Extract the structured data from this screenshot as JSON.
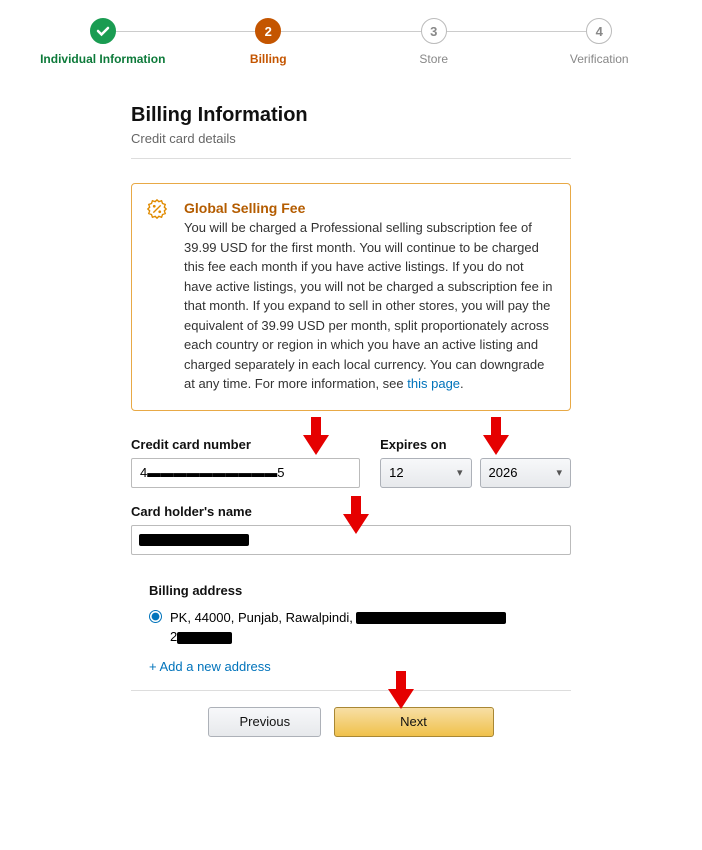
{
  "stepper": {
    "steps": [
      {
        "label": "Individual Information"
      },
      {
        "label": "Billing",
        "num": "2"
      },
      {
        "label": "Store",
        "num": "3"
      },
      {
        "label": "Verification",
        "num": "4"
      }
    ]
  },
  "header": {
    "title": "Billing Information",
    "subtitle": "Credit card details"
  },
  "notice": {
    "title": "Global Selling Fee",
    "body": "You will be charged a Professional selling subscription fee of 39.99 USD for the first month. You will continue to be charged this fee each month if you have active listings. If you do not have active listings, you will not be charged a subscription fee in that month. If you expand to sell in other stores, you will pay the equivalent of 39.99 USD per month, split proportionately across each country or region in which you have an active listing and charged separately in each local currency. You can downgrade at any time. For more information, see ",
    "link_text": "this page",
    "period": "."
  },
  "form": {
    "card_number_label": "Credit card number",
    "card_number_value": "4▬▬▬▬▬▬▬▬▬▬5",
    "expires_label": "Expires on",
    "exp_month": "12",
    "exp_year": "2026",
    "holder_label": "Card holder's name",
    "holder_value": "",
    "billing_label": "Billing address",
    "billing_addr_prefix": "PK, 44000, Punjab, Rawalpindi, ",
    "billing_addr_line2_prefix": "2",
    "add_address": "+ Add a new address"
  },
  "buttons": {
    "previous": "Previous",
    "next": "Next"
  }
}
